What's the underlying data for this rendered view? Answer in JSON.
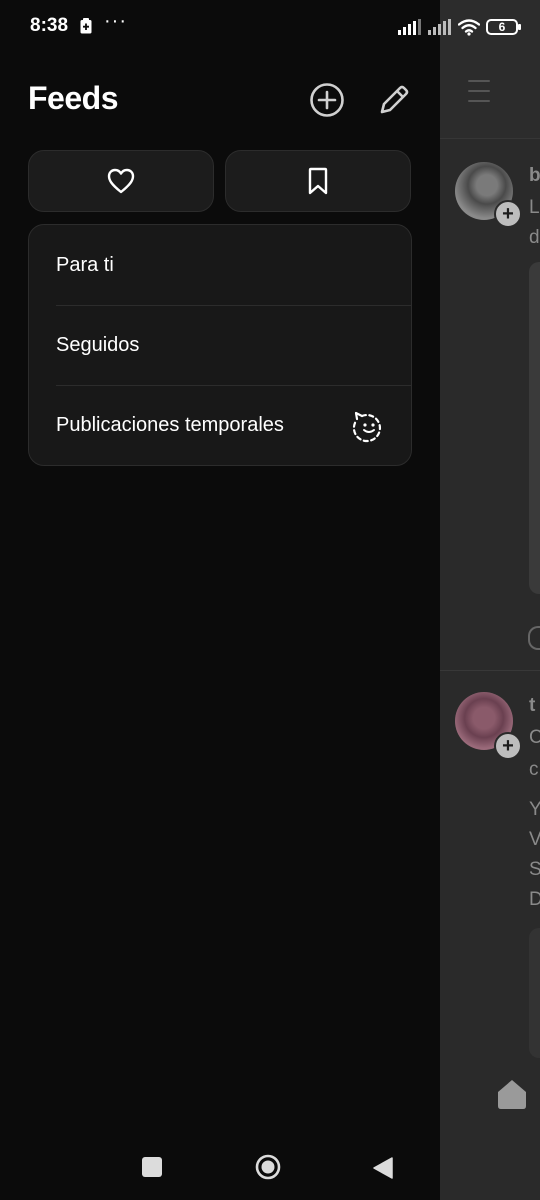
{
  "status_bar": {
    "time": "8:38",
    "more": "···",
    "battery": "6"
  },
  "drawer": {
    "title": "Feeds",
    "feeds": [
      {
        "label": "Para ti",
        "icon": ""
      },
      {
        "label": "Seguidos",
        "icon": ""
      },
      {
        "label": "Publicaciones temporales",
        "icon": "ghost-face-icon"
      }
    ]
  },
  "background": {
    "post1": {
      "author_initial": "b",
      "line1": "L",
      "line2": "d"
    },
    "post2": {
      "author_initial": "t",
      "line1": "C",
      "line2": "c",
      "body": [
        "Y",
        "V",
        "S",
        "D"
      ]
    }
  },
  "colors": {
    "drawer_bg": "#0b0b0b",
    "card_bg": "#1c1c1c",
    "background_feed": "#2a2a2a"
  }
}
